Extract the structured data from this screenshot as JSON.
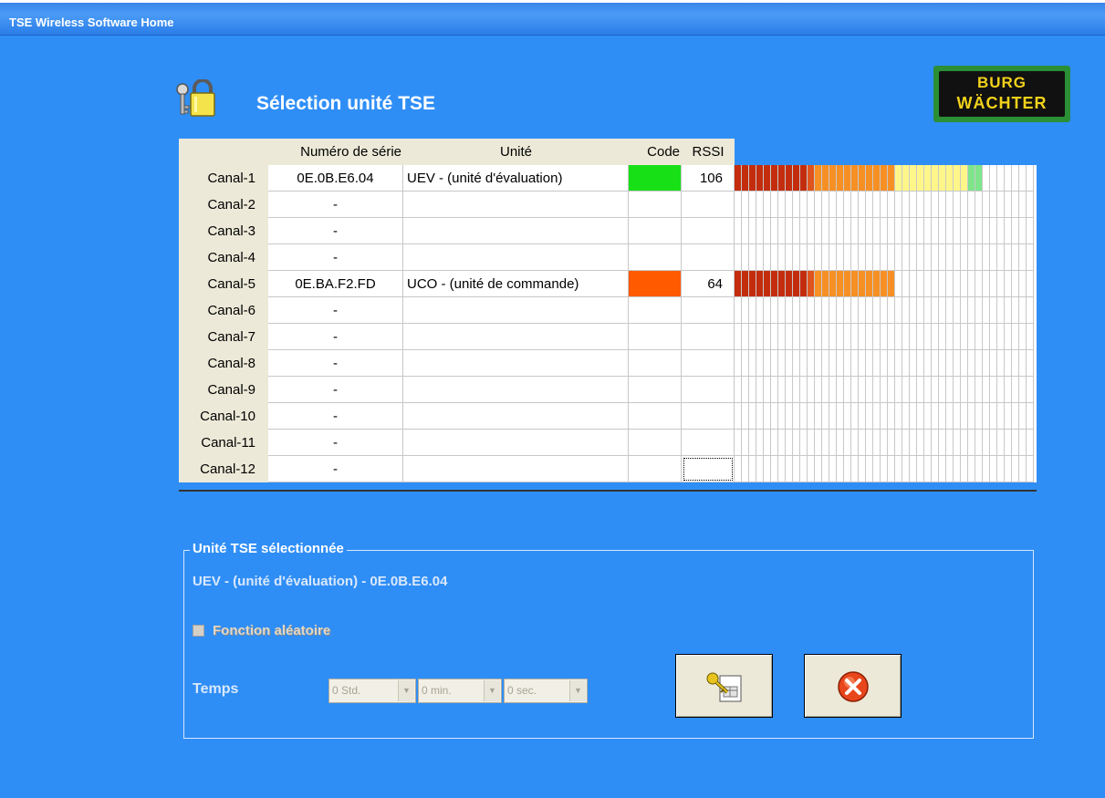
{
  "window": {
    "title": "TSE Wireless Software Home"
  },
  "header": {
    "title": "Sélection unité TSE",
    "icon": "lock-keys-icon"
  },
  "logo": {
    "line1": "BURG",
    "line2": "WÄCHTER"
  },
  "table": {
    "columns": [
      "Numéro de série",
      "Unité",
      "Code",
      "RSSI"
    ],
    "rows": [
      {
        "canal": "Canal-1",
        "serial": "0E.0B.E6.04",
        "unit": "UEV - (unité d'évaluation)",
        "code_color": "#17e017",
        "rssi": "106",
        "signal_segments": 34
      },
      {
        "canal": "Canal-2",
        "serial": "-",
        "unit": "",
        "code_color": "",
        "rssi": "",
        "signal_segments": 0
      },
      {
        "canal": "Canal-3",
        "serial": "-",
        "unit": "",
        "code_color": "",
        "rssi": "",
        "signal_segments": 0
      },
      {
        "canal": "Canal-4",
        "serial": "-",
        "unit": "",
        "code_color": "",
        "rssi": "",
        "signal_segments": 0
      },
      {
        "canal": "Canal-5",
        "serial": "0E.BA.F2.FD",
        "unit": "UCO - (unité de commande)",
        "code_color": "#ff5a00",
        "rssi": "64",
        "signal_segments": 22
      },
      {
        "canal": "Canal-6",
        "serial": "-",
        "unit": "",
        "code_color": "",
        "rssi": "",
        "signal_segments": 0
      },
      {
        "canal": "Canal-7",
        "serial": "-",
        "unit": "",
        "code_color": "",
        "rssi": "",
        "signal_segments": 0
      },
      {
        "canal": "Canal-8",
        "serial": "-",
        "unit": "",
        "code_color": "",
        "rssi": "",
        "signal_segments": 0
      },
      {
        "canal": "Canal-9",
        "serial": "-",
        "unit": "",
        "code_color": "",
        "rssi": "",
        "signal_segments": 0
      },
      {
        "canal": "Canal-10",
        "serial": "-",
        "unit": "",
        "code_color": "",
        "rssi": "",
        "signal_segments": 0
      },
      {
        "canal": "Canal-11",
        "serial": "-",
        "unit": "",
        "code_color": "",
        "rssi": "",
        "signal_segments": 0
      },
      {
        "canal": "Canal-12",
        "serial": "-",
        "unit": "",
        "code_color": "",
        "rssi": "",
        "signal_segments": 0
      }
    ],
    "meter_colors": [
      "#c32d0d",
      "#e0541e",
      "#f69024",
      "#fff68a",
      "#7ee58b"
    ]
  },
  "selection": {
    "legend": "Unité TSE sélectionnée",
    "text": "UEV - (unité d'évaluation) - 0E.0B.E6.04",
    "checkbox_label": "Fonction aléatoire",
    "checkbox_checked": false,
    "temps_label": "Temps",
    "hours": "0 Std.",
    "minutes": "0 min.",
    "seconds": "0 sec."
  },
  "buttons": {
    "confirm_icon": "keys-document-icon",
    "cancel_icon": "cancel-x-icon"
  }
}
